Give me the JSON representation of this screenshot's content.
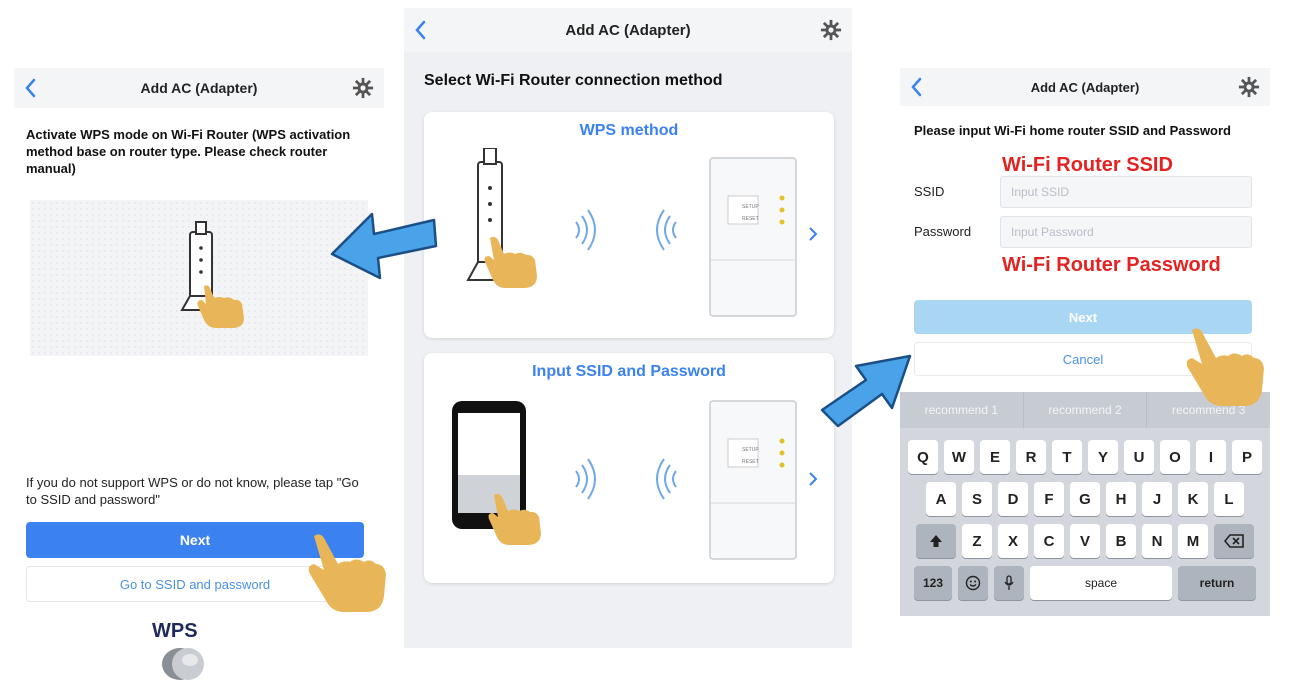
{
  "left": {
    "title": "Add AC (Adapter)",
    "instruction": "Activate WPS mode on Wi-Fi Router (WPS activation method base on router type. Please check router manual)",
    "note": "If you do not support WPS or do not know, please tap \"Go to SSID and password\"",
    "next_label": "Next",
    "goto_label": "Go to SSID and password",
    "wps_button_label": "WPS"
  },
  "center": {
    "title": "Add AC (Adapter)",
    "section_title": "Select Wi-Fi Router connection method",
    "cards": [
      {
        "label": "WPS method"
      },
      {
        "label": "Input SSID and Password"
      }
    ]
  },
  "right": {
    "title": "Add AC (Adapter)",
    "prompt": "Please input Wi-Fi home router SSID and Password",
    "ssid_annotation": "Wi-Fi Router SSID",
    "password_annotation": "Wi-Fi Router Password",
    "ssid_label": "SSID",
    "ssid_placeholder": "Input SSID",
    "password_label": "Password",
    "password_placeholder": "Input Password",
    "next_label": "Next",
    "cancel_label": "Cancel",
    "keyboard": {
      "suggestions": [
        "recommend 1",
        "recommend 2",
        "recommend 3"
      ],
      "row1": [
        "Q",
        "W",
        "E",
        "R",
        "T",
        "Y",
        "U",
        "O",
        "I",
        "P"
      ],
      "row2": [
        "A",
        "S",
        "D",
        "F",
        "G",
        "H",
        "J",
        "K",
        "L"
      ],
      "row3": [
        "Z",
        "X",
        "C",
        "V",
        "B",
        "N",
        "M"
      ],
      "num_key": "123",
      "space_key": "space",
      "return_key": "return"
    }
  },
  "colors": {
    "accent_blue": "#3b82f0",
    "annotation_red": "#e32222",
    "arrow_blue": "#4aa3e8",
    "hand": "#e8b658"
  },
  "icons": [
    "back-chevron-icon",
    "gear-icon",
    "router-icon",
    "hand-pointer-icon",
    "wifi-signal-icon",
    "adapter-icon",
    "smartphone-icon",
    "chevron-right-icon",
    "arrow-icon",
    "microphone-icon",
    "emoji-icon",
    "shift-icon",
    "backspace-icon"
  ]
}
